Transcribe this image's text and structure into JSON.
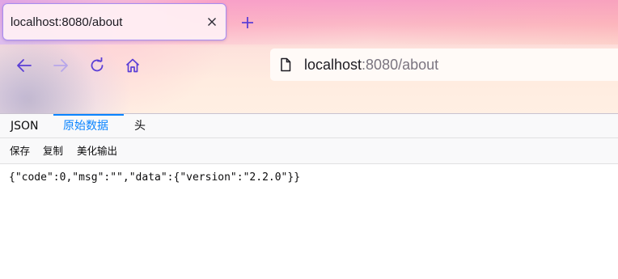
{
  "browser": {
    "tab": {
      "title": "localhost:8080/about",
      "close_icon": "close-icon"
    },
    "new_tab_icon": "plus-icon",
    "nav": {
      "back_icon": "arrow-left-icon",
      "forward_icon": "arrow-right-icon",
      "reload_icon": "reload-icon",
      "home_icon": "home-icon"
    },
    "url": {
      "host": "localhost",
      "rest": ":8080/about",
      "page_icon": "page-icon"
    },
    "accent": "#5b3fd6"
  },
  "viewer": {
    "tabs": [
      {
        "label": "JSON"
      },
      {
        "label": "原始数据"
      },
      {
        "label": "头"
      }
    ],
    "selected_tab": "原始数据",
    "toolbar": {
      "save": "保存",
      "copy": "复制",
      "pretty": "美化输出"
    },
    "raw_text": "{\"code\":0,\"msg\":\"\",\"data\":{\"version\":\"2.2.0\"}}",
    "accent": "#0a84ff"
  }
}
